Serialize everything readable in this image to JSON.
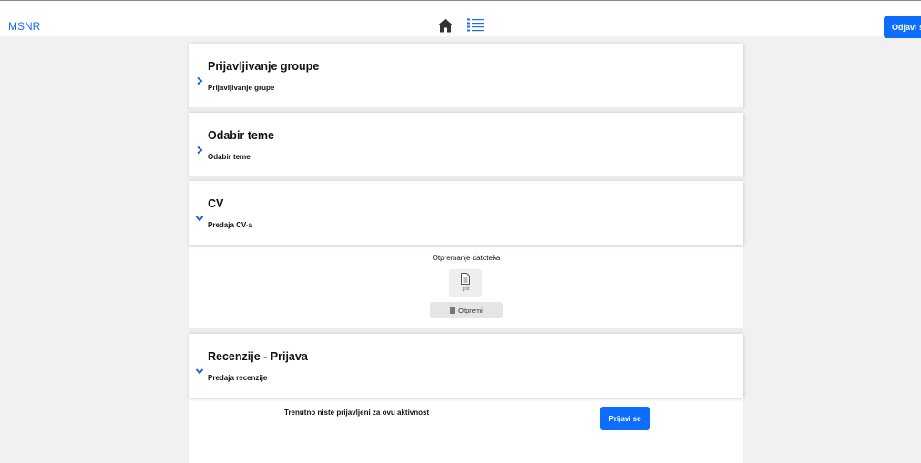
{
  "header": {
    "brand": "MSNR",
    "logout_label": "Odjavi se"
  },
  "activities": [
    {
      "title": "Prijavljivanje groupe",
      "subtitle": "Prijavljivanje grupe",
      "state": "collapsed"
    },
    {
      "title": "Odabir teme",
      "subtitle": "Odabir teme",
      "state": "collapsed"
    },
    {
      "title": "CV",
      "subtitle": "Predaja CV-a",
      "state": "expanded"
    },
    {
      "title": "Recenzije - Prijava",
      "subtitle": "Predaja recenzije",
      "state": "expanded"
    }
  ],
  "upload": {
    "title": "Otpremanje datoteka",
    "file_ext": ".pdf",
    "button_label": "Otpremi"
  },
  "review": {
    "status_text": "Trenutno niste prijavljeni za ovu aktivnost",
    "button_label": "Prijavi se"
  },
  "colors": {
    "accent": "#0d6efd",
    "brand": "#1a6dff",
    "chevron": "#1565d8",
    "page_bg": "#f1f1f1"
  },
  "icons": {
    "home": "home-icon",
    "list": "list-icon",
    "collapsed_chevron": "chevron-right-icon",
    "expanded_chevron": "chevron-down-icon",
    "file": "file-pdf-icon",
    "upload_doc": "document-icon"
  }
}
